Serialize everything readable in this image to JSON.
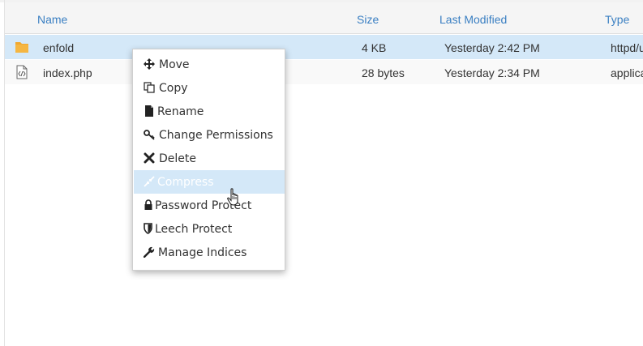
{
  "columns": {
    "name": "Name",
    "size": "Size",
    "modified": "Last Modified",
    "type": "Type"
  },
  "files": [
    {
      "name": "enfold",
      "size": "4 KB",
      "modified": "Yesterday 2:42 PM",
      "type": "httpd/u",
      "icon": "folder-icon",
      "selected": true
    },
    {
      "name": "index.php",
      "size": "28 bytes",
      "modified": "Yesterday 2:34 PM",
      "type": "applica",
      "icon": "code-file-icon",
      "selected": false
    }
  ],
  "context_menu": {
    "items": [
      {
        "label": "Move",
        "icon": "move-icon"
      },
      {
        "label": "Copy",
        "icon": "copy-icon"
      },
      {
        "label": "Rename",
        "icon": "rename-icon"
      },
      {
        "label": "Change Permissions",
        "icon": "key-icon"
      },
      {
        "label": "Delete",
        "icon": "delete-icon"
      },
      {
        "label": "Compress",
        "icon": "compress-icon",
        "hovered": true
      },
      {
        "label": "Password Protect",
        "icon": "lock-icon"
      },
      {
        "label": "Leech Protect",
        "icon": "shield-icon"
      },
      {
        "label": "Manage Indices",
        "icon": "wrench-icon"
      }
    ]
  },
  "colors": {
    "header_text": "#3a7fc2",
    "selected_row": "#d4e8f8",
    "folder": "#f0a830"
  }
}
